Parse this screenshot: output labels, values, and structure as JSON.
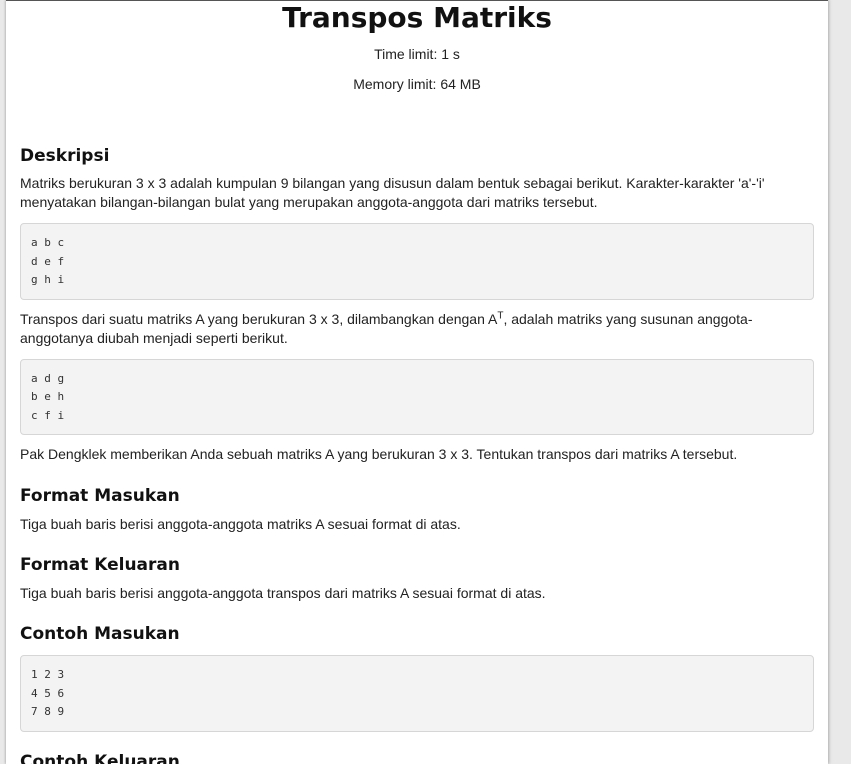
{
  "problem": {
    "title": "Transpos Matriks",
    "time_limit": "Time limit: 1 s",
    "memory_limit": "Memory limit: 64 MB"
  },
  "sections": {
    "description": {
      "heading": "Deskripsi",
      "para1": "Matriks berukuran 3 x 3 adalah kumpulan 9 bilangan yang disusun dalam bentuk sebagai berikut. Karakter-karakter 'a'-'i' menyatakan bilangan-bilangan bulat yang merupakan anggota-anggota dari matriks tersebut.",
      "matrix1": "a b c\nd e f\ng h i",
      "para2_before": "Transpos dari suatu matriks A yang berukuran 3 x 3, dilambangkan dengan A",
      "para2_sup": "T",
      "para2_after": ", adalah matriks yang susunan anggota-anggotanya diubah menjadi seperti berikut.",
      "matrix2": "a d g\nb e h\nc f i",
      "para3": "Pak Dengklek memberikan Anda sebuah matriks A yang berukuran 3 x 3. Tentukan transpos dari matriks A tersebut."
    },
    "input_format": {
      "heading": "Format Masukan",
      "text": "Tiga buah baris berisi anggota-anggota matriks A sesuai format di atas."
    },
    "output_format": {
      "heading": "Format Keluaran",
      "text": "Tiga buah baris berisi anggota-anggota transpos dari matriks A sesuai format di atas."
    },
    "sample_input": {
      "heading": "Contoh Masukan",
      "text": "1 2 3\n4 5 6\n7 8 9"
    },
    "sample_output": {
      "heading": "Contoh Keluaran"
    }
  }
}
